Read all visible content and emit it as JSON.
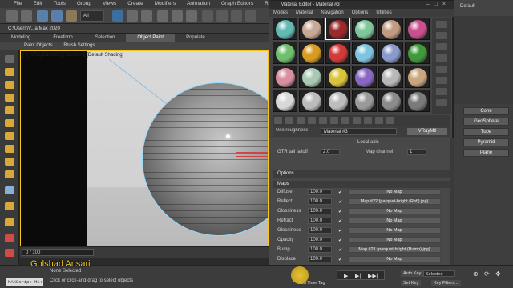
{
  "app": {
    "menu": [
      "File",
      "Edit",
      "Tools",
      "Group",
      "Views",
      "Create",
      "Modifiers",
      "Animation",
      "Graph Editors",
      "Rendering"
    ],
    "path": "C:\\Users\\V...a Max 2020",
    "ribbon_tabs": [
      "Modeling",
      "Freeform",
      "Selection",
      "Object Paint",
      "Populate"
    ],
    "ribbon_active": "Object Paint",
    "subribbon": [
      "Paint Objects",
      "Brush Settings"
    ],
    "selection_filter": "All"
  },
  "viewport": {
    "label": "[+] [VRayCam001] [Standard] [Default Shading]",
    "border_color": "#f5c518"
  },
  "timeline": {
    "counter": "0 / 100"
  },
  "status": {
    "maxscript": "MAXScript Mi:",
    "line1": "None Selected",
    "line2": "Click or click-and-drag to select objects",
    "watermark": "Golshad Ansari",
    "add_time_tag": "Add Time Tag",
    "auto_key": "Auto Key",
    "set_key": "Set Key",
    "selected": "Selected",
    "key_filters": "Key Filters..."
  },
  "material_editor": {
    "title": "Material Editor - Material #3",
    "menu": [
      "Modes",
      "Material",
      "Navigation",
      "Options",
      "Utilities"
    ],
    "slot_colors": [
      "#63b9b3",
      "#c9a896",
      "#9b2a2a",
      "#7fc79a",
      "#c29a82",
      "#c9508e",
      "#6fbf6f",
      "#d89a1f",
      "#d23a3a",
      "#7ec3e0",
      "#8a9acc",
      "#3f9a3a",
      "#d88fa0",
      "#a9c9b4",
      "#d8c33a",
      "#8a67c3",
      "#b8b8b8",
      "#c9a67e",
      "#d8d8d8",
      "#bcbcbc",
      "#bdbdbd",
      "#9a9a9a",
      "#8c8c8c",
      "#7a7a7a"
    ],
    "selected_slot": 2,
    "material_name": "Material #3",
    "material_type": "VRayMtl",
    "use_roughness": "Use roughness",
    "local_axis": "Local axis",
    "gtr_tail_falloff": "GTR tail falloff",
    "gtr_value": "2.0",
    "map_channel_label": "Map channel",
    "map_channel_value": "1",
    "sections": [
      "Options",
      "Maps"
    ],
    "maps": [
      {
        "label": "Diffuse",
        "amount": "100.0",
        "map": "No Map"
      },
      {
        "label": "Reflect",
        "amount": "100.0",
        "map": "Map #22 (parquet-bright (Refl).jpg)"
      },
      {
        "label": "Glossiness",
        "amount": "100.0",
        "map": "No Map"
      },
      {
        "label": "Refract",
        "amount": "100.0",
        "map": "No Map"
      },
      {
        "label": "Glossiness",
        "amount": "100.0",
        "map": "No Map"
      },
      {
        "label": "Opacity",
        "amount": "100.0",
        "map": "No Map"
      },
      {
        "label": "Bump",
        "amount": "100.0",
        "map": "Map #21 (parquet-bright (Bump).jpg)"
      },
      {
        "label": "Displace",
        "amount": "100.0",
        "map": "No Map"
      },
      {
        "label": "Self-illum",
        "amount": "100.0",
        "map": "No Map"
      }
    ]
  },
  "command_panel": {
    "default_label": "Default",
    "buttons": [
      "Cone",
      "GeoSphere",
      "Tube",
      "Pyramid",
      "Plane"
    ]
  }
}
